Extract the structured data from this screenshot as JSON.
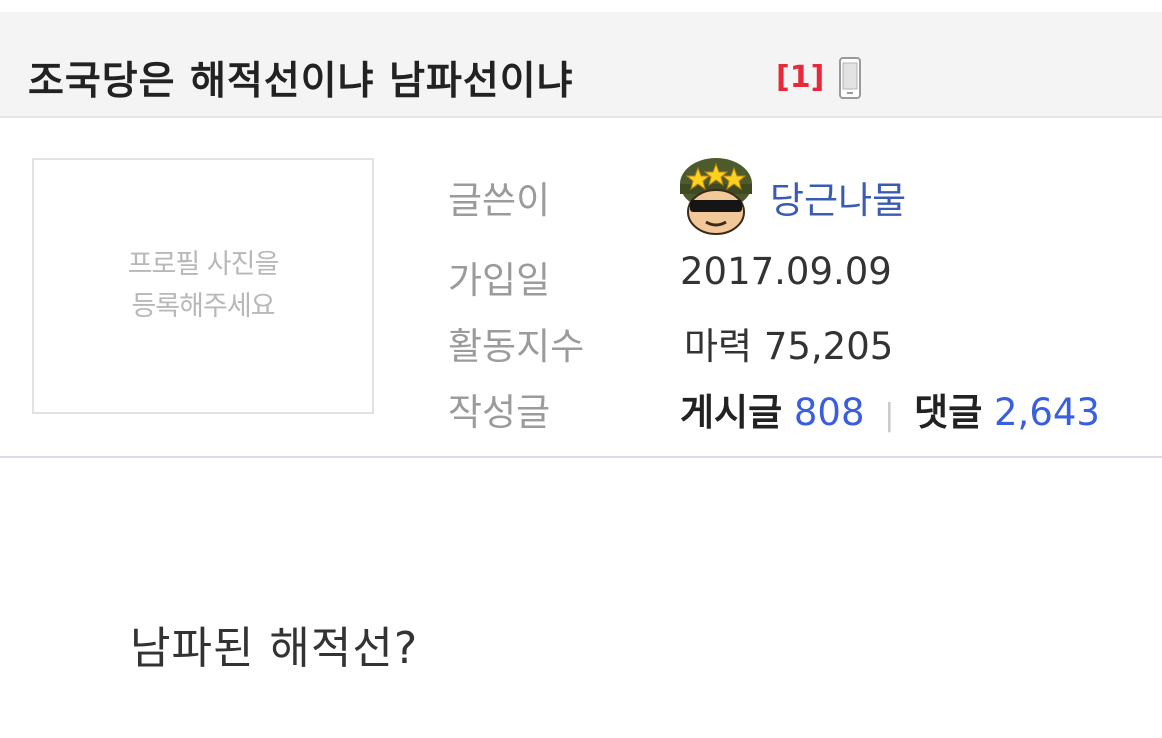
{
  "post": {
    "title": "조국당은 해적선이냐 남파선이냐",
    "comment_count": "[1]",
    "mobile_icon": "mobile-phone-icon",
    "body": "남파된 해적선?"
  },
  "profile": {
    "placeholder_line1": "프로필 사진을",
    "placeholder_line2": "등록해주세요"
  },
  "author_info": {
    "writer_label": "글쓴이",
    "nickname": "당근나물",
    "avatar_icon": "pixel-soldier-avatar-icon",
    "join_label": "가입일",
    "join_date": "2017.09.09",
    "activity_label": "활동지수",
    "activity_value": "마력 75,205",
    "posts_label": "작성글",
    "posts_prefix": "게시글",
    "posts_count": "808",
    "separator": "|",
    "comments_prefix": "댓글",
    "comments_count": "2,643"
  },
  "colors": {
    "title_bar_bg": "#f4f4f4",
    "comment_count": "#e8293a",
    "nickname": "#3b5bb3",
    "count_blue": "#3a5ee0",
    "label_gray": "#9b9b9b"
  }
}
